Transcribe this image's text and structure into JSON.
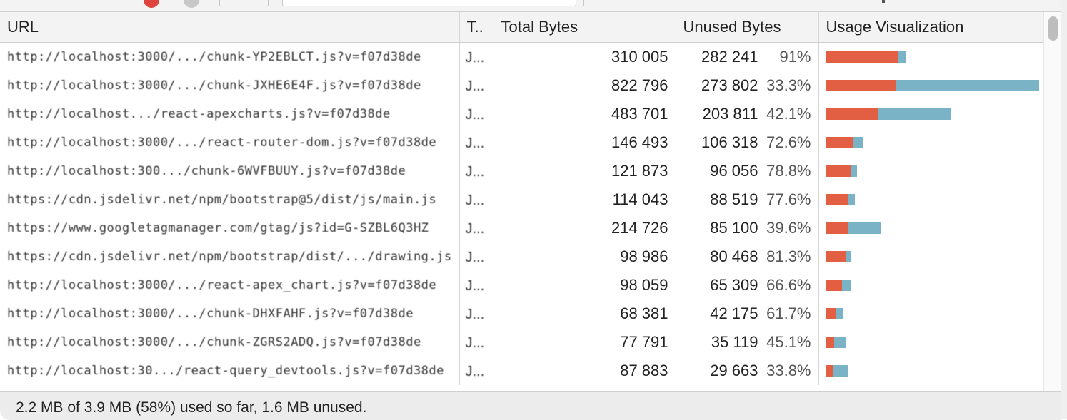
{
  "columns": {
    "url": "URL",
    "type": "T..",
    "total": "Total Bytes",
    "unused": "Unused Bytes",
    "viz": "Usage Visualization"
  },
  "rows": [
    {
      "url": "http://localhost:3000/.../chunk-YP2EBLCT.js?v=f07d38de",
      "type": "J...",
      "total": "310 005",
      "unused": "282 241",
      "pct": "91%",
      "total_bytes": 310005,
      "unused_bytes": 282241
    },
    {
      "url": "http://localhost:3000/.../chunk-JXHE6E4F.js?v=f07d38de",
      "type": "J...",
      "total": "822 796",
      "unused": "273 802",
      "pct": "33.3%",
      "total_bytes": 822796,
      "unused_bytes": 273802
    },
    {
      "url": "http://localhost.../react-apexcharts.js?v=f07d38de",
      "type": "J...",
      "total": "483 701",
      "unused": "203 811",
      "pct": "42.1%",
      "total_bytes": 483701,
      "unused_bytes": 203811
    },
    {
      "url": "http://localhost:3000/.../react-router-dom.js?v=f07d38de",
      "type": "J...",
      "total": "146 493",
      "unused": "106 318",
      "pct": "72.6%",
      "total_bytes": 146493,
      "unused_bytes": 106318
    },
    {
      "url": "http://localhost:300.../chunk-6WVFBUUY.js?v=f07d38de",
      "type": "J...",
      "total": "121 873",
      "unused": "96 056",
      "pct": "78.8%",
      "total_bytes": 121873,
      "unused_bytes": 96056
    },
    {
      "url": "https://cdn.jsdelivr.net/npm/bootstrap@5/dist/js/main.js",
      "type": "J...",
      "total": "114 043",
      "unused": "88 519",
      "pct": "77.6%",
      "total_bytes": 114043,
      "unused_bytes": 88519
    },
    {
      "url": "https://www.googletagmanager.com/gtag/js?id=G-SZBL6Q3HZ",
      "type": "J...",
      "total": "214 726",
      "unused": "85 100",
      "pct": "39.6%",
      "total_bytes": 214726,
      "unused_bytes": 85100
    },
    {
      "url": "https://cdn.jsdelivr.net/npm/bootstrap/dist/.../drawing.js",
      "type": "J...",
      "total": "98 986",
      "unused": "80 468",
      "pct": "81.3%",
      "total_bytes": 98986,
      "unused_bytes": 80468
    },
    {
      "url": "http://localhost:3000/.../react-apex_chart.js?v=f07d38de",
      "type": "J...",
      "total": "98 059",
      "unused": "65 309",
      "pct": "66.6%",
      "total_bytes": 98059,
      "unused_bytes": 65309
    },
    {
      "url": "http://localhost:3000/.../chunk-DHXFAHF.js?v=f07d38de",
      "type": "J...",
      "total": "68 381",
      "unused": "42 175",
      "pct": "61.7%",
      "total_bytes": 68381,
      "unused_bytes": 42175
    },
    {
      "url": "http://localhost:3000/.../chunk-ZGRS2ADQ.js?v=f07d38de",
      "type": "J...",
      "total": "77 791",
      "unused": "35 119",
      "pct": "45.1%",
      "total_bytes": 77791,
      "unused_bytes": 35119
    },
    {
      "url": "http://localhost:30.../react-query_devtools.js?v=f07d38de",
      "type": "J...",
      "total": "87 883",
      "unused": "29 663",
      "pct": "33.8%",
      "total_bytes": 87883,
      "unused_bytes": 29663
    }
  ],
  "footer": {
    "summary": "2.2 MB of 3.9 MB (58%) used so far, 1.6 MB unused."
  },
  "colors": {
    "used": "#e35f43",
    "unused": "#7ab3c6"
  }
}
